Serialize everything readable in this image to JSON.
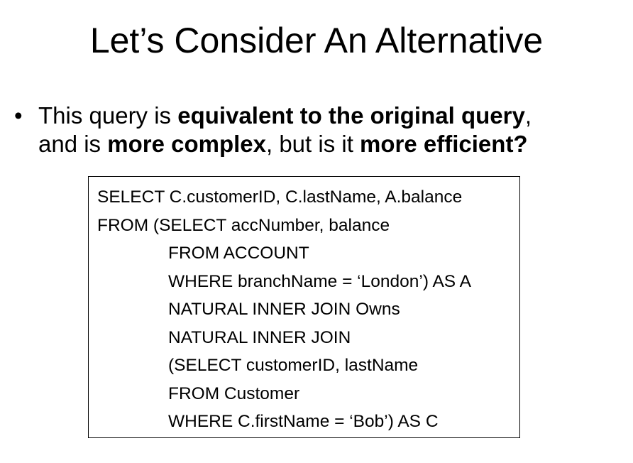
{
  "slide": {
    "title": "Let’s Consider An Alternative",
    "bullet": {
      "marker": "•",
      "line1_part1": "This query is ",
      "line1_bold": "equivalent to the original query",
      "line1_part2": ",",
      "line2_part1": "and is ",
      "line2_bold1": "more complex",
      "line2_part2": ", but is it ",
      "line2_bold2": "more efficient?"
    },
    "code_lines": [
      "SELECT C.customerID, C.lastName, A.balance",
      "FROM (SELECT accNumber, balance",
      "FROM ACCOUNT",
      "WHERE branchName = ‘London’) AS A",
      "NATURAL INNER JOIN Owns",
      "NATURAL INNER JOIN",
      "(SELECT customerID, lastName",
      "FROM Customer",
      "WHERE C.firstName = ‘Bob’) AS C"
    ]
  }
}
